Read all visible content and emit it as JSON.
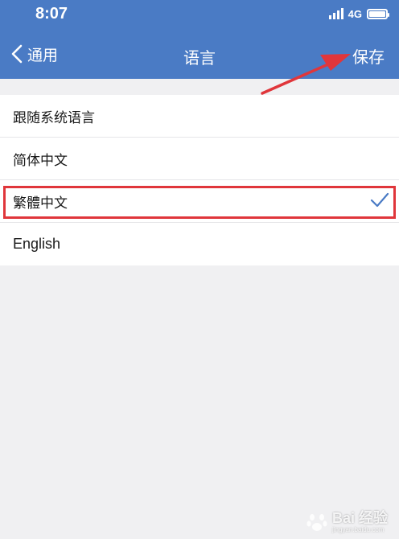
{
  "status_bar": {
    "time": "8:07",
    "network": "4G",
    "icons": [
      "signal-icon",
      "battery-icon"
    ]
  },
  "nav": {
    "back_label": "通用",
    "title": "语言",
    "save_label": "保存",
    "color": "#4a7bc5"
  },
  "languages": {
    "items": [
      {
        "label": "跟随系统语言",
        "selected": false
      },
      {
        "label": "简体中文",
        "selected": false
      },
      {
        "label": "繁體中文",
        "selected": true
      },
      {
        "label": "English",
        "selected": false
      }
    ]
  },
  "annotations": {
    "highlight_color": "#e0363b",
    "arrow_color": "#e0363b"
  },
  "watermark": {
    "text": "Bai 经验",
    "sub": "jingyan.baidu.com"
  }
}
